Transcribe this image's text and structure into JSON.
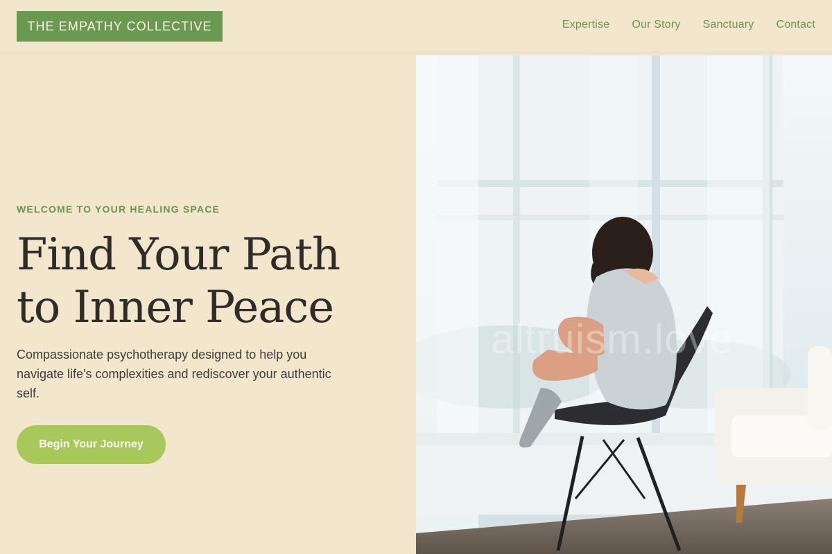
{
  "brand": {
    "name": "THE EMPATHY COLLECTIVE"
  },
  "nav": {
    "items": [
      {
        "label": "Expertise"
      },
      {
        "label": "Our Story"
      },
      {
        "label": "Sanctuary"
      },
      {
        "label": "Contact"
      }
    ]
  },
  "hero": {
    "eyebrow": "WELCOME TO YOUR HEALING SPACE",
    "headline_line1": "Find Your Path",
    "headline_line2": "to Inner Peace",
    "description": "Compassionate psychotherapy designed to help you navigate life's complexities and rediscover your authentic self.",
    "cta_label": "Begin Your Journey",
    "image_watermark": "altruism.love"
  },
  "colors": {
    "background": "#f2e6cc",
    "brand_green": "#6a9a52",
    "nav_text": "#6b9355",
    "cta": "#a8c95a",
    "headline": "#2e2b28"
  }
}
